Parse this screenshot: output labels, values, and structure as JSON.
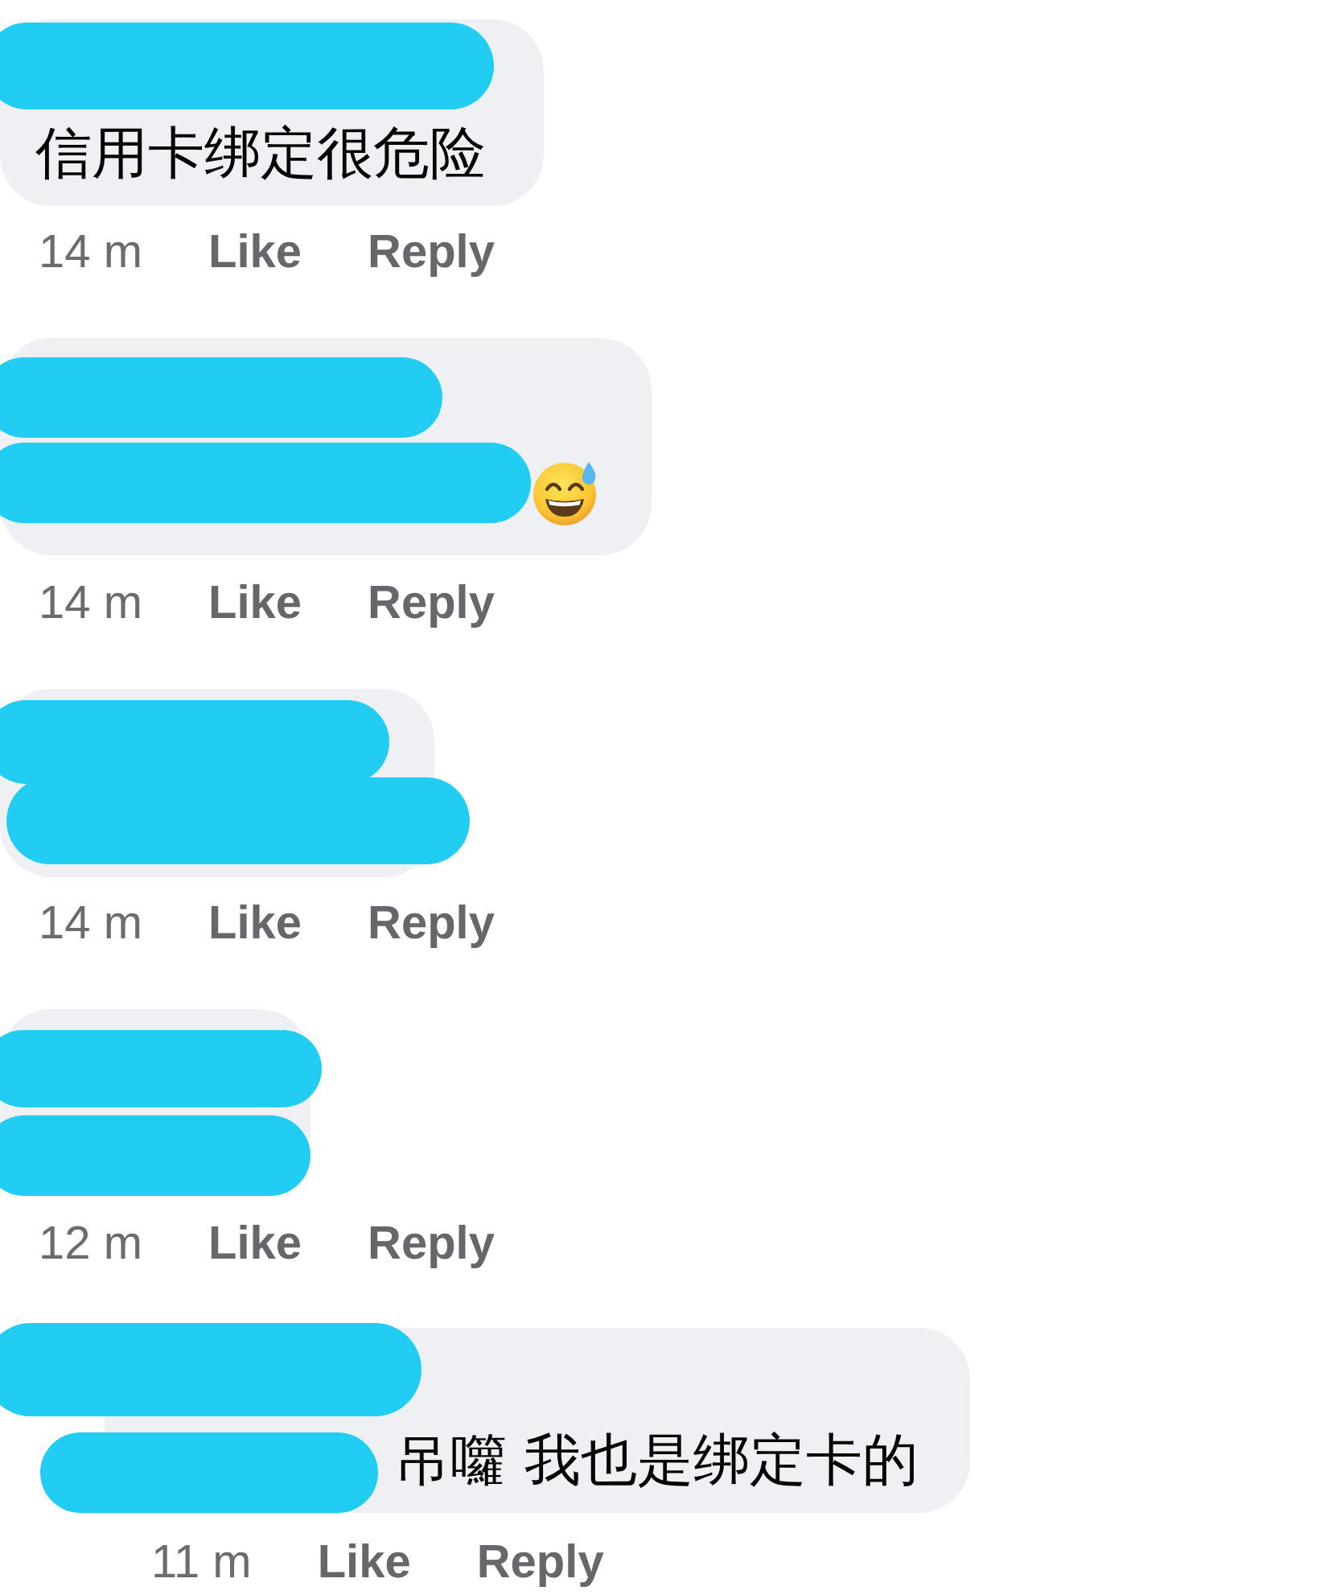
{
  "comments": [
    {
      "is_reply": false,
      "lines": [
        {
          "kind": "redacted"
        },
        {
          "kind": "text",
          "text": "信用卡绑定很危险"
        }
      ],
      "time": "14 m",
      "actions": [
        "Like",
        "Reply"
      ]
    },
    {
      "is_reply": false,
      "lines": [
        {
          "kind": "redacted"
        },
        {
          "kind": "redacted",
          "emoji": true
        }
      ],
      "time": "14 m",
      "actions": [
        "Like",
        "Reply"
      ]
    },
    {
      "is_reply": false,
      "lines": [
        {
          "kind": "redacted"
        },
        {
          "kind": "redacted"
        }
      ],
      "time": "14 m",
      "actions": [
        "Like",
        "Reply"
      ]
    },
    {
      "is_reply": false,
      "lines": [
        {
          "kind": "redacted"
        },
        {
          "kind": "redacted"
        }
      ],
      "time": "12 m",
      "actions": [
        "Like",
        "Reply"
      ]
    },
    {
      "is_reply": true,
      "lines": [
        {
          "kind": "redacted"
        },
        {
          "kind": "partly_redacted",
          "text": "吊囖 我也是绑定卡的"
        }
      ],
      "time": "11 m",
      "actions": [
        "Like",
        "Reply"
      ]
    }
  ]
}
